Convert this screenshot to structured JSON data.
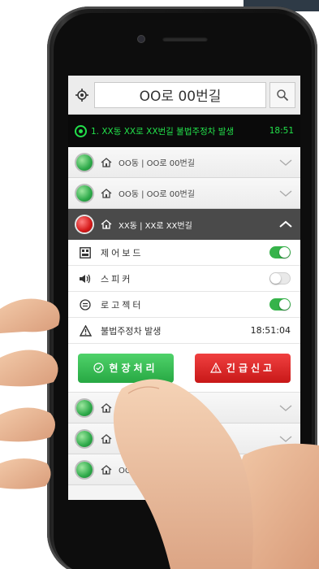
{
  "search": {
    "value": "OO로 00번길"
  },
  "alert": {
    "text": "1. XX동 XX로 XX번길 불법주정차 발생",
    "time": "18:51",
    "color": "#22e04a"
  },
  "locations_top": [
    {
      "label": "OO동 | OO로 00번길",
      "status": "green"
    },
    {
      "label": "OO동 | OO로 00번길",
      "status": "green"
    }
  ],
  "active_location": {
    "label": "XX동 | XX로 XX번길",
    "status": "red"
  },
  "devices": [
    {
      "icon": "control-board-icon",
      "label": "제어보드",
      "toggle": true
    },
    {
      "icon": "speaker-icon",
      "label": "스피커",
      "toggle": false
    },
    {
      "icon": "projector-icon",
      "label": "로고젝터",
      "toggle": true
    }
  ],
  "event": {
    "label": "불법주정차 발생",
    "time": "18:51:04"
  },
  "buttons": {
    "onsite": "현장처리",
    "emergency": "긴급신고"
  },
  "locations_bottom": [
    {
      "label": "",
      "status": "green"
    },
    {
      "label": "",
      "status": "green"
    },
    {
      "label": "OO동 | OO로 00번",
      "status": "green"
    }
  ],
  "colors": {
    "green": "#2eaa4a",
    "red": "#d61a1a",
    "toggle_on": "#36b34a",
    "active_row": "#4a4a4a"
  }
}
